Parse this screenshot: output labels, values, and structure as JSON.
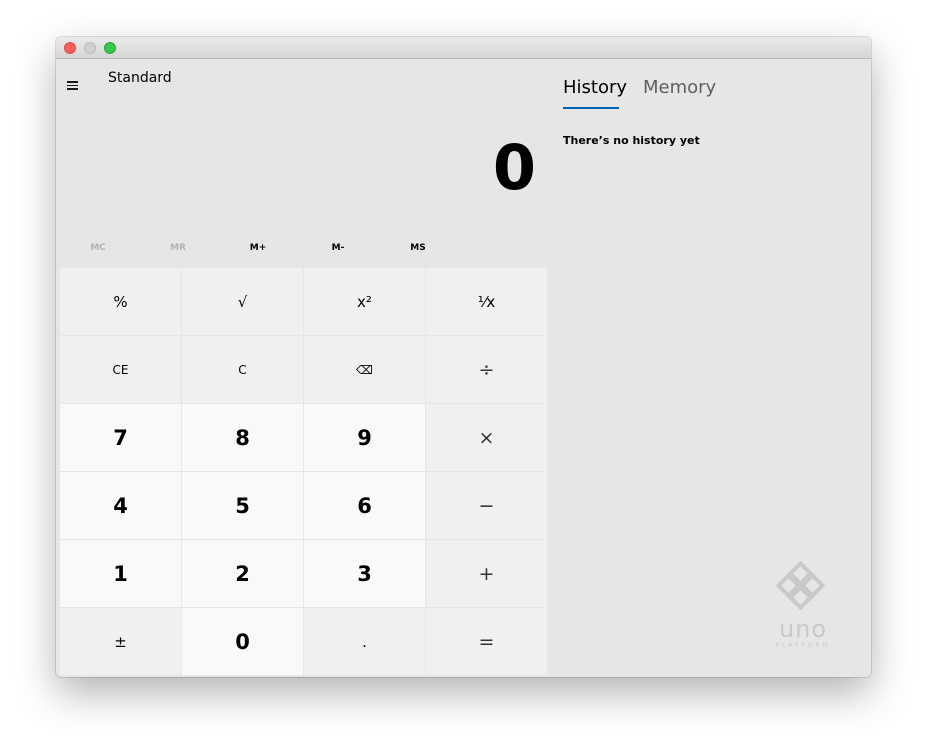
{
  "window": {
    "traffic_lights": [
      "close",
      "minimize",
      "maximize"
    ]
  },
  "calculator": {
    "menu_icon": "hamburger-icon",
    "mode_title": "Standard",
    "display_value": "0",
    "memory_buttons": [
      {
        "label": "MC",
        "enabled": false
      },
      {
        "label": "MR",
        "enabled": false
      },
      {
        "label": "M+",
        "enabled": true
      },
      {
        "label": "M-",
        "enabled": true
      },
      {
        "label": "MS",
        "enabled": true
      }
    ],
    "keys": [
      {
        "label": "%",
        "kind": "fn",
        "name": "percent"
      },
      {
        "label": "√",
        "kind": "fn",
        "name": "square-root"
      },
      {
        "label": "x²",
        "kind": "fn",
        "name": "square"
      },
      {
        "label": "⅟x",
        "kind": "fn",
        "name": "reciprocal"
      },
      {
        "label": "CE",
        "kind": "fn",
        "name": "clear-entry"
      },
      {
        "label": "C",
        "kind": "fn",
        "name": "clear"
      },
      {
        "label": "⌫",
        "kind": "fn",
        "name": "backspace"
      },
      {
        "label": "÷",
        "kind": "op",
        "name": "divide"
      },
      {
        "label": "7",
        "kind": "num",
        "name": "digit-7"
      },
      {
        "label": "8",
        "kind": "num",
        "name": "digit-8"
      },
      {
        "label": "9",
        "kind": "num",
        "name": "digit-9"
      },
      {
        "label": "×",
        "kind": "op",
        "name": "multiply"
      },
      {
        "label": "4",
        "kind": "num",
        "name": "digit-4"
      },
      {
        "label": "5",
        "kind": "num",
        "name": "digit-5"
      },
      {
        "label": "6",
        "kind": "num",
        "name": "digit-6"
      },
      {
        "label": "−",
        "kind": "op",
        "name": "subtract"
      },
      {
        "label": "1",
        "kind": "num",
        "name": "digit-1"
      },
      {
        "label": "2",
        "kind": "num",
        "name": "digit-2"
      },
      {
        "label": "3",
        "kind": "num",
        "name": "digit-3"
      },
      {
        "label": "+",
        "kind": "op",
        "name": "add"
      },
      {
        "label": "±",
        "kind": "fn",
        "name": "negate"
      },
      {
        "label": "0",
        "kind": "num",
        "name": "digit-0"
      },
      {
        "label": ".",
        "kind": "fn",
        "name": "decimal"
      },
      {
        "label": "=",
        "kind": "op",
        "name": "equals"
      }
    ]
  },
  "side_panel": {
    "tabs": [
      {
        "label": "History",
        "active": true
      },
      {
        "label": "Memory",
        "active": false
      }
    ],
    "empty_message": "There’s no history yet"
  },
  "branding": {
    "logo_word": "uno",
    "logo_sub": "PLATFORM"
  },
  "colors": {
    "accent": "#0063b1",
    "window_bg": "#e6e6e6",
    "number_key_bg": "#f9f9f9",
    "function_key_bg": "#f0f0f0"
  }
}
